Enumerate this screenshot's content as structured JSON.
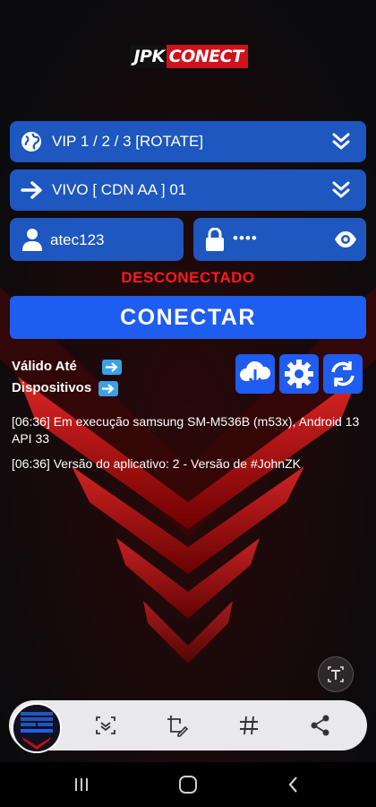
{
  "app": {
    "logo_part1": "JPK",
    "logo_part2": "CONECT"
  },
  "server": {
    "label": "VIP 1 / 2 / 3 [ROTATE]",
    "icon": "globe-icon"
  },
  "network": {
    "label": "VIVO [ CDN AA ] 01",
    "icon": "arrow-right-icon"
  },
  "username": {
    "value": "atec123",
    "icon": "user-icon"
  },
  "password": {
    "value": "••••",
    "icon": "lock-icon"
  },
  "status": {
    "text": "DESCONECTADO"
  },
  "connect_button": {
    "label": "CONECTAR"
  },
  "info": {
    "valid_until_label": "Válido Até",
    "devices_label": "Dispositivos"
  },
  "log": [
    {
      "text": "[06:36] Em execução samsung SM-M536B (m53x), Android 13 API 33"
    },
    {
      "text": "[06:36] Versão do aplicativo: 2 - Versão de #JohnZK"
    }
  ],
  "colors": {
    "field": "#1d57bf",
    "button": "#1f5cf0",
    "status": "#ff1a1a",
    "accent_red": "#d0121b"
  }
}
